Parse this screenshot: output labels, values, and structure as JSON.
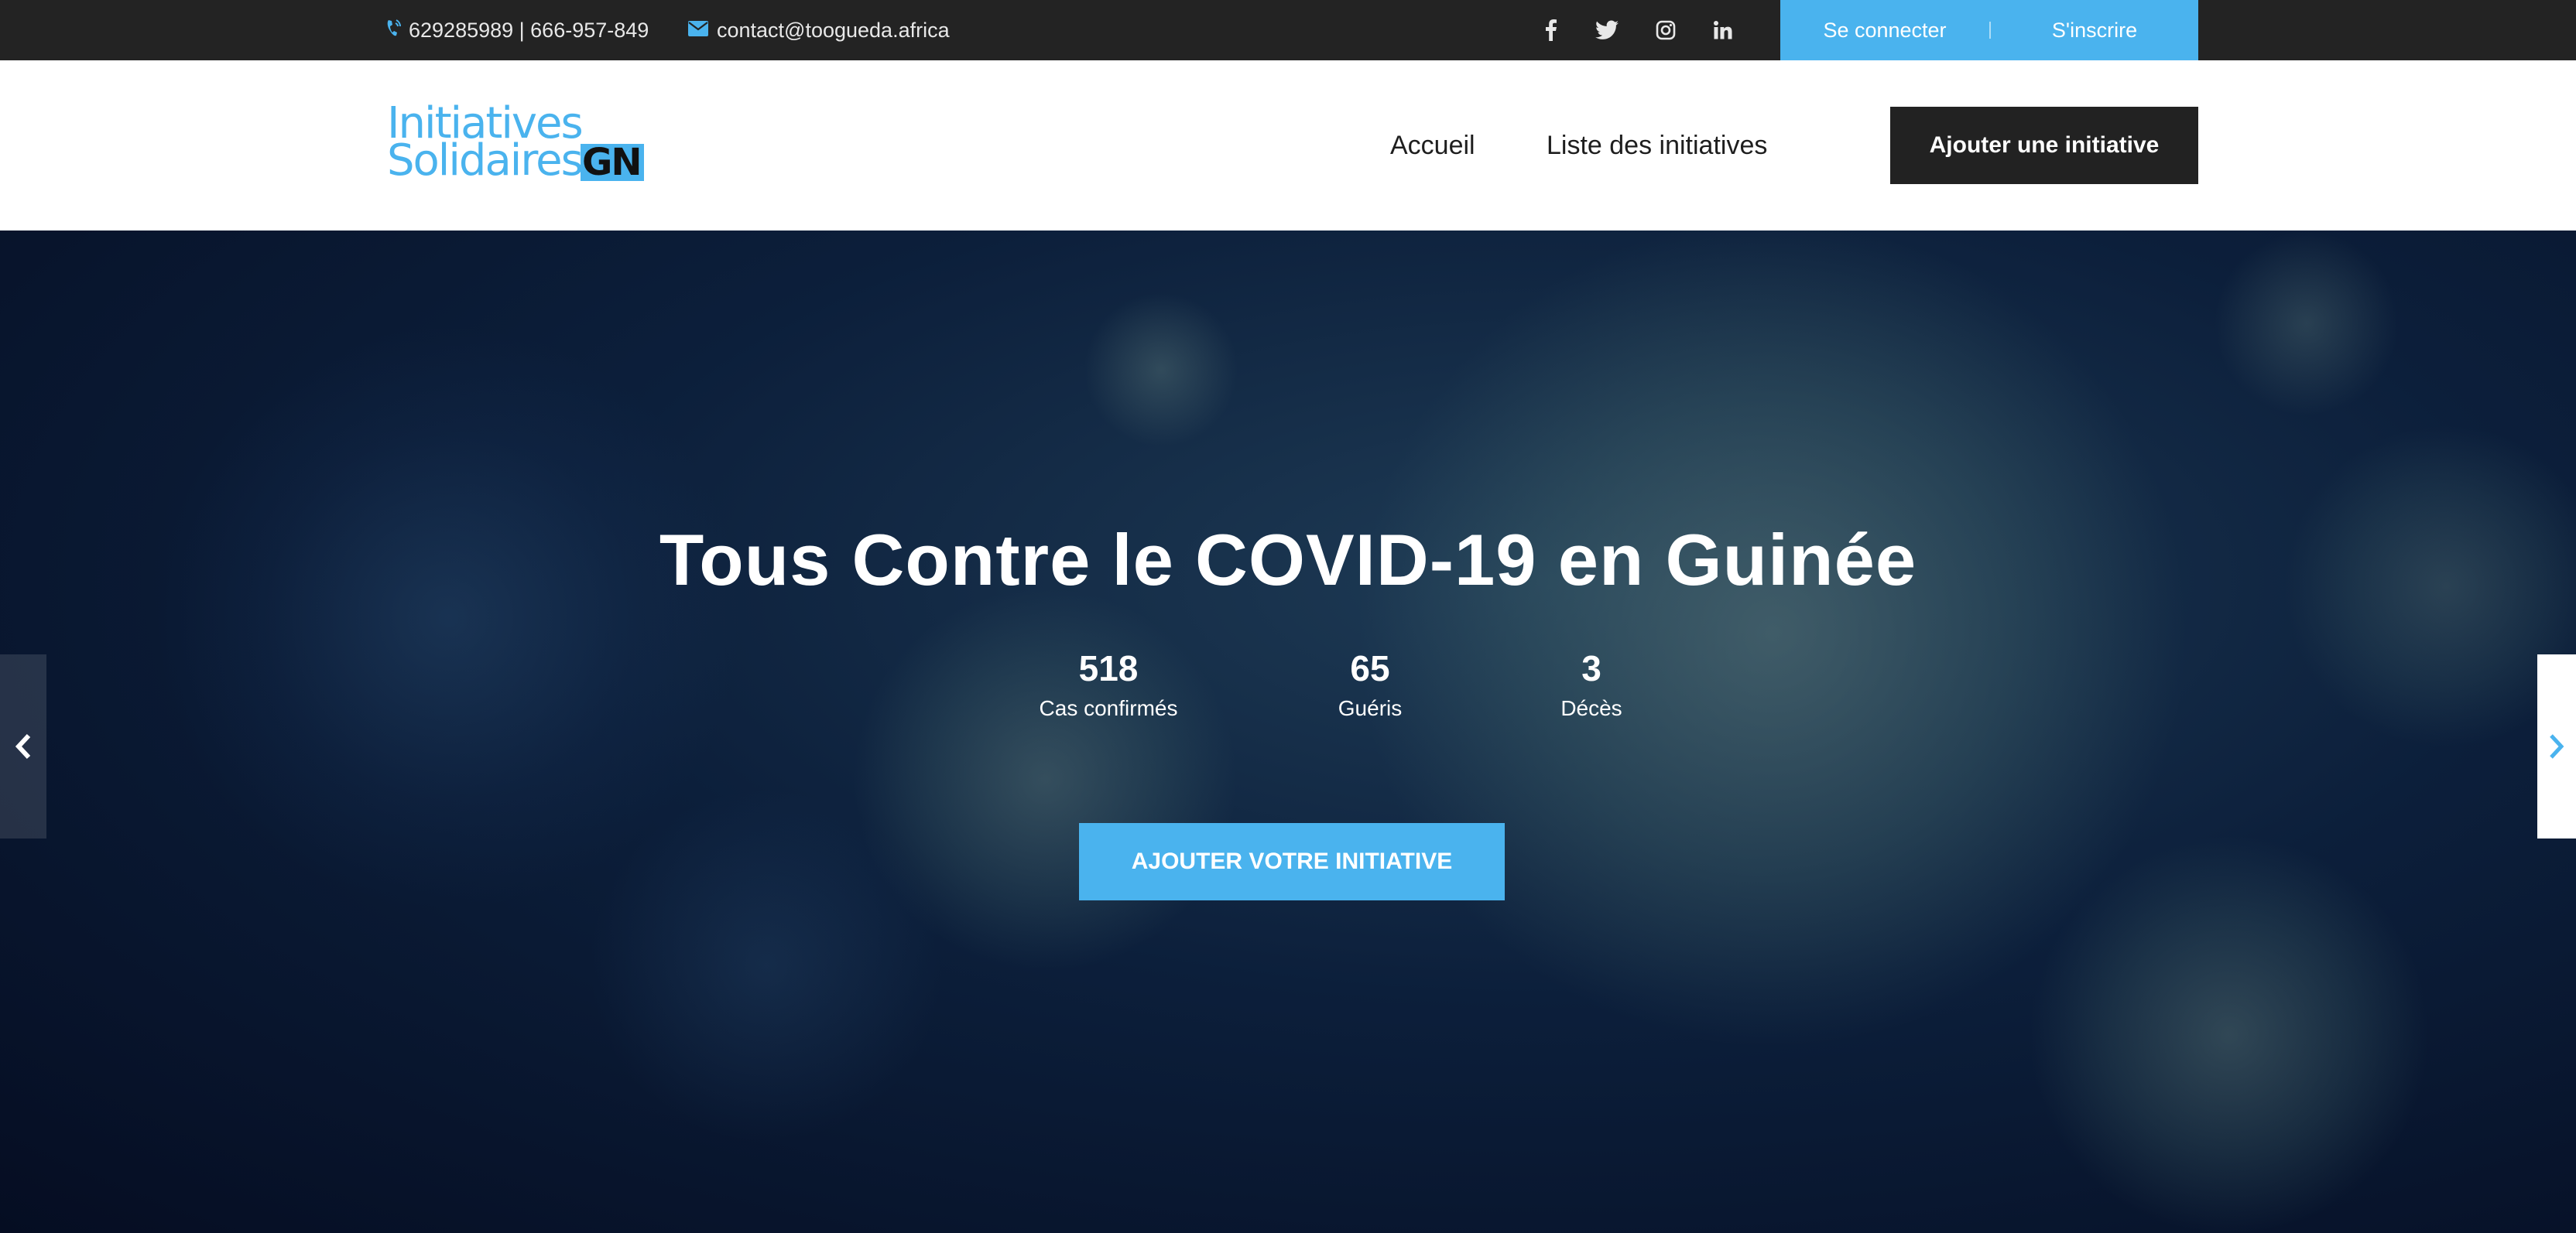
{
  "topbar": {
    "phone": "629285989 | 666-957-849",
    "email": "contact@toogueda.africa",
    "social_icons": [
      "facebook-icon",
      "twitter-icon",
      "instagram-icon",
      "linkedin-icon"
    ],
    "login_label": "Se connecter",
    "signup_label": "S'inscrire"
  },
  "header": {
    "logo": {
      "line1": "Initiatives",
      "line2": "Solidaires",
      "badge": "GN"
    },
    "nav": [
      {
        "label": "Accueil"
      },
      {
        "label": "Liste des initiatives"
      }
    ],
    "add_button_label": "Ajouter une initiative"
  },
  "hero": {
    "title": "Tous Contre le COVID-19 en Guinée",
    "stats": [
      {
        "value": "518",
        "label": "Cas confirmés"
      },
      {
        "value": "65",
        "label": "Guéris"
      },
      {
        "value": "3",
        "label": "Décès"
      }
    ],
    "cta_label": "AJOUTER VOTRE INITIATIVE",
    "prev_icon": "chevron-left-icon",
    "next_icon": "chevron-right-icon"
  },
  "colors": {
    "accent": "#4ab3ee",
    "topbar_bg": "#232323",
    "dark_button": "#222222",
    "hero_bg": "#0c1f3b"
  }
}
